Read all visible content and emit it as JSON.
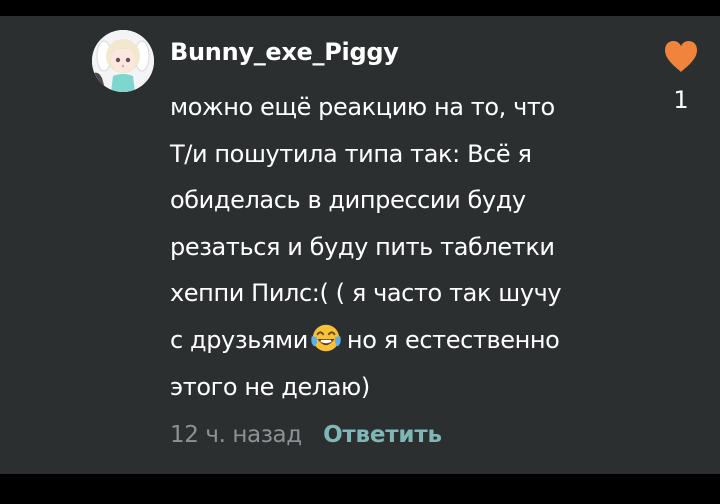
{
  "comment": {
    "username": "Bunny_exe_Piggy",
    "lines": [
      "можно ещё реакцию на то, что",
      "Т/и пошутила типа так: Всё я",
      "обиделась в дипрессии буду",
      "резаться и буду пить таблетки",
      "хеппи Пилс:( ( я часто так шучу"
    ],
    "line6_before_emoji": "с друзьями",
    "line6_after_emoji": "но я естественно",
    "line7": "этого не делаю)",
    "emoji": "face-with-tears-of-joy-icon",
    "timestamp": "12 ч. назад",
    "reply_label": "Ответить",
    "like_count": "1"
  },
  "colors": {
    "background": "#2b2f30",
    "text": "#ffffff",
    "timestamp": "#8c9296",
    "reply": "#7fb7b7",
    "heart": "#f0843c"
  }
}
